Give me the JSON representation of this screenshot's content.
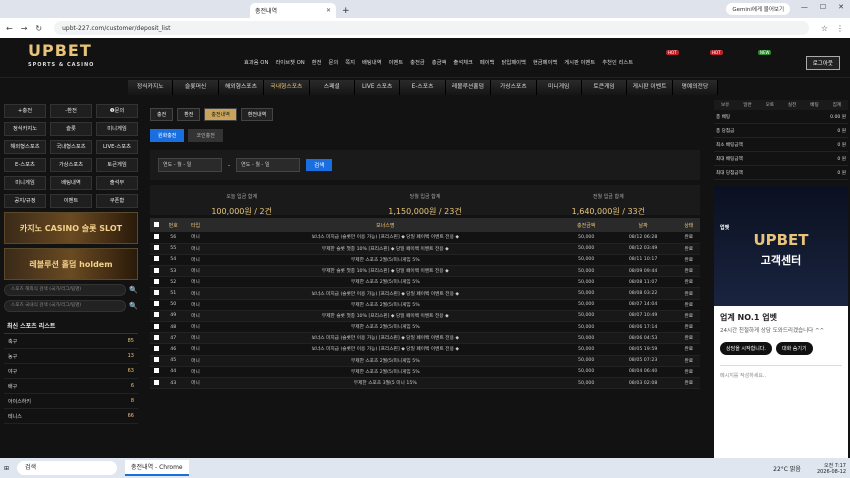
{
  "browser": {
    "tab_title": "충전내역",
    "gemini": "Gemini에게 물어보기",
    "url": "upbt-227.com/customer/deposit_list"
  },
  "header": {
    "logo": "UPBET",
    "logo_sub": "SPORTS & CASINO",
    "links": [
      "효과음 ON",
      "라이브챗 ON",
      "환전",
      "문의",
      "쪽지",
      "배팅내역",
      "이벤트",
      "충전금",
      "총금액",
      "출석체크",
      "페이백",
      "닭입페이백",
      "현금페이백",
      "게시판 이벤트",
      "추천인 리스트"
    ],
    "hot": "HOT",
    "new": "NEW",
    "login": "로그아웃"
  },
  "nav": [
    "정식카지노",
    "슬롯머신",
    "해외형스포츠",
    "국내형스포츠",
    "스페셜",
    "LIVE 스포츠",
    "E-스포츠",
    "레볼루션홀덤",
    "가상스포츠",
    "미니게임",
    "토큰게임",
    "게시판 이벤트",
    "명예의전당"
  ],
  "left": {
    "buttons": [
      "+충전",
      "-환전",
      "❶문의",
      "정식카지노",
      "슬롯",
      "미니게임",
      "해외형스포츠",
      "국내형스포츠",
      "LIVE-스포츠",
      "E-스포츠",
      "가상스포츠",
      "토큰게임",
      "미니게임",
      "배팅내역",
      "출석부",
      "공지/규정",
      "이벤트",
      "쿠폰함"
    ],
    "banner1": "카지노 CASINO 슬롯 SLOT",
    "banner2": "레볼루션 홀덤 holdem",
    "search1": "스포츠 해외식 검색 (국가/리그/팀명)",
    "search2": "스포츠 국내식 검색 (국가/리그/팀명)",
    "sport_title": "최신 스포츠 리스트",
    "sports": [
      {
        "name": "축구",
        "n": "85"
      },
      {
        "name": "농구",
        "n": "13"
      },
      {
        "name": "야구",
        "n": "63"
      },
      {
        "name": "배구",
        "n": "6"
      },
      {
        "name": "아이스하키",
        "n": "8"
      },
      {
        "name": "테니스",
        "n": "66"
      }
    ]
  },
  "main": {
    "tabs": [
      "충전",
      "환전",
      "충전내역",
      "환전내역"
    ],
    "subtabs": [
      "원화충전",
      "코인충전"
    ],
    "date_from": "연도 - 월 - 일",
    "date_to": "연도 - 월 - 일",
    "search": "검색",
    "summary": [
      {
        "t": "오늘 입금 합계",
        "v": "100,000원 / 2건"
      },
      {
        "t": "당월 입금 합계",
        "v": "1,150,000원 / 23건"
      },
      {
        "t": "전월 입금 합계",
        "v": "1,640,000원 / 33건"
      }
    ],
    "columns": [
      "",
      "번호",
      "타입",
      "보너스명",
      "충전금액",
      "날짜",
      "상태"
    ],
    "rows": [
      [
        "56",
        "머니",
        "보너스 미지급 (슬롯만 이용 가능) [프리스핀] ◆ 당일 페이백 이벤트 전용 ◆",
        "50,000",
        "08/12 06:28",
        "완료"
      ],
      [
        "55",
        "머니",
        "무제한 슬롯 첫충 10% [프리스핀] ◆ 당일 페이백 이벤트 전용 ◆",
        "50,000",
        "08/12 03:49",
        "완료"
      ],
      [
        "54",
        "머니",
        "무제한 스포츠 2월(5/미니게임 5%",
        "50,000",
        "08/11 10:17",
        "완료"
      ],
      [
        "53",
        "머니",
        "무제한 슬롯 첫충 10% [프리스핀] ◆ 당일 페이백 이벤트 전용 ◆",
        "50,000",
        "08/09 09:44",
        "완료"
      ],
      [
        "52",
        "머니",
        "무제한 스포츠 2월(5/미니게임 5%",
        "50,000",
        "08/08 11:07",
        "완료"
      ],
      [
        "51",
        "머니",
        "보너스 미지급 (슬롯만 이용 가능) [프리스핀] ◆ 당일 페이백 이벤트 전용 ◆",
        "50,000",
        "08/08 03:22",
        "완료"
      ],
      [
        "50",
        "머니",
        "무제한 스포츠 2월(5/미니게임 5%",
        "50,000",
        "08/07 14:04",
        "완료"
      ],
      [
        "49",
        "머니",
        "무제한 슬롯 첫충 10% [프리스핀] ◆ 당일 페이백 이벤트 전용 ◆",
        "50,000",
        "08/07 10:49",
        "완료"
      ],
      [
        "48",
        "머니",
        "무제한 스포츠 2월(5/미니게임 5%",
        "50,000",
        "08/06 17:14",
        "완료"
      ],
      [
        "47",
        "머니",
        "보너스 미지급 (슬롯만 이용 가능) [프리스핀] ◆ 당일 페이백 이벤트 전용 ◆",
        "50,000",
        "08/06 04:53",
        "완료"
      ],
      [
        "46",
        "머니",
        "보너스 미지급 (슬롯만 이용 가능) [프리스핀] ◆ 당일 페이백 이벤트 전용 ◆",
        "50,000",
        "08/05 19:59",
        "완료"
      ],
      [
        "45",
        "머니",
        "무제한 스포츠 2월(5/미니게임 5%",
        "50,000",
        "08/05 07:23",
        "완료"
      ],
      [
        "44",
        "머니",
        "무제한 스포츠 2월(5/미니게임 5%",
        "50,000",
        "08/04 06:40",
        "완료"
      ],
      [
        "43",
        "머니",
        "무제한 스포츠 3월(5 미니 15%",
        "50,000",
        "08/03 02:08",
        "완료"
      ]
    ]
  },
  "right": {
    "tabs": [
      "보유",
      "일반",
      "오토",
      "실전",
      "배팅",
      "집계"
    ],
    "rows": [
      {
        "k": "총 배팅",
        "v": "0.00 원"
      },
      {
        "k": "총 당첨금",
        "v": "0 원"
      },
      {
        "k": "최소 배팅금액",
        "v": "0 원"
      },
      {
        "k": "최대 배팅금액",
        "v": "0 원"
      },
      {
        "k": "최대 당첨금액",
        "v": "0 원"
      }
    ]
  },
  "chat": {
    "label": "업벳",
    "big": "UPBET",
    "ko": "고객센터",
    "title": "업계 NO.1 업벳",
    "sub": "24시간 친절하게 상담 도와드리겠습니다 ^^",
    "btn1": "상담을 시작합니다.",
    "btn2": "대화 숨기기",
    "placeholder": "메시지를 작성하세요.."
  },
  "taskbar": {
    "search": "검색",
    "app": "충전내역 - Chrome",
    "weather": "22°C 맑음",
    "time": "오전 7:17",
    "date": "2026-08-12"
  }
}
